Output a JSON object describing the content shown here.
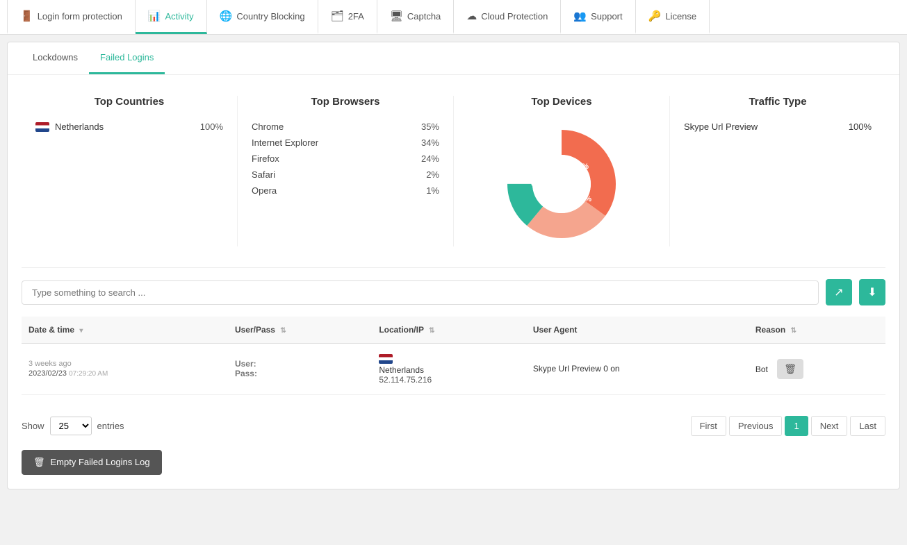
{
  "nav": {
    "tabs": [
      {
        "id": "login",
        "label": "Login form protection",
        "icon": "🚪",
        "active": false
      },
      {
        "id": "activity",
        "label": "Activity",
        "icon": "📊",
        "active": true
      },
      {
        "id": "country",
        "label": "Country Blocking",
        "icon": "🌐",
        "active": false
      },
      {
        "id": "twofa",
        "label": "2FA",
        "icon": "🗂",
        "active": false
      },
      {
        "id": "captcha",
        "label": "Captcha",
        "icon": "🖥",
        "active": false
      },
      {
        "id": "cloud",
        "label": "Cloud Protection",
        "icon": "☁",
        "active": false
      },
      {
        "id": "support",
        "label": "Support",
        "icon": "👥",
        "active": false
      },
      {
        "id": "license",
        "label": "License",
        "icon": "🔑",
        "active": false
      }
    ]
  },
  "subtabs": {
    "tabs": [
      {
        "id": "lockdowns",
        "label": "Lockdowns",
        "active": false
      },
      {
        "id": "failedlogins",
        "label": "Failed Logins",
        "active": true
      }
    ]
  },
  "stats": {
    "top_countries": {
      "title": "Top Countries",
      "items": [
        {
          "flag": "nl",
          "name": "Netherlands",
          "pct": "100%"
        }
      ]
    },
    "top_browsers": {
      "title": "Top Browsers",
      "items": [
        {
          "name": "Chrome",
          "pct": "35%"
        },
        {
          "name": "Internet Explorer",
          "pct": "34%"
        },
        {
          "name": "Firefox",
          "pct": "24%"
        },
        {
          "name": "Safari",
          "pct": "2%"
        },
        {
          "name": "Opera",
          "pct": "1%"
        }
      ]
    },
    "top_devices": {
      "title": "Top Devices",
      "segments": [
        {
          "label": "60%",
          "value": 60,
          "color": "#f26c4f"
        },
        {
          "label": "26%",
          "value": 26,
          "color": "#f5a58e"
        },
        {
          "label": "14%",
          "value": 14,
          "color": "#2db89b"
        }
      ]
    },
    "traffic_type": {
      "title": "Traffic Type",
      "items": [
        {
          "name": "Skype Url Preview",
          "pct": "100%"
        }
      ]
    }
  },
  "search": {
    "placeholder": "Type something to search ..."
  },
  "table": {
    "headers": [
      {
        "label": "Date & time",
        "sortable": true
      },
      {
        "label": "User/Pass",
        "sortable": true
      },
      {
        "label": "Location/IP",
        "sortable": true
      },
      {
        "label": "User Agent",
        "sortable": false
      },
      {
        "label": "Reason",
        "sortable": true
      }
    ],
    "rows": [
      {
        "time_ago": "3 weeks ago",
        "datetime": "2023/02/23",
        "time_hms": "07:29:20 AM",
        "user_label": "User:",
        "user_val": "",
        "pass_label": "Pass:",
        "pass_val": "",
        "flag": "nl",
        "location": "Netherlands",
        "ip": "52.114.75.216",
        "user_agent": "Skype Url Preview 0 on",
        "reason": "Bot"
      }
    ]
  },
  "pagination": {
    "show_label": "Show",
    "entries_label": "entries",
    "per_page": "25",
    "per_page_options": [
      "10",
      "25",
      "50",
      "100"
    ],
    "buttons": [
      "First",
      "Previous",
      "1",
      "Next",
      "Last"
    ],
    "current_page": "1"
  },
  "footer": {
    "empty_log_btn": "Empty Failed Logins Log"
  },
  "icons": {
    "export_icon": "↗",
    "download_icon": "⬇",
    "trash_icon": "🗑"
  }
}
